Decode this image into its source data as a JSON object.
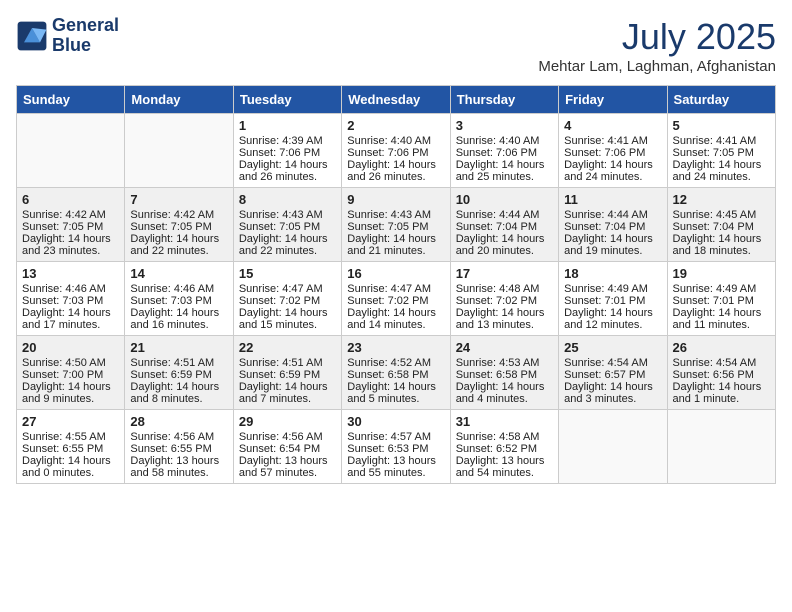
{
  "header": {
    "logo_line1": "General",
    "logo_line2": "Blue",
    "month": "July 2025",
    "location": "Mehtar Lam, Laghman, Afghanistan"
  },
  "weekdays": [
    "Sunday",
    "Monday",
    "Tuesday",
    "Wednesday",
    "Thursday",
    "Friday",
    "Saturday"
  ],
  "weeks": [
    [
      {
        "day": "",
        "sunrise": "",
        "sunset": "",
        "daylight": "",
        "empty": true
      },
      {
        "day": "",
        "sunrise": "",
        "sunset": "",
        "daylight": "",
        "empty": true
      },
      {
        "day": "1",
        "sunrise": "Sunrise: 4:39 AM",
        "sunset": "Sunset: 7:06 PM",
        "daylight": "Daylight: 14 hours and 26 minutes.",
        "empty": false
      },
      {
        "day": "2",
        "sunrise": "Sunrise: 4:40 AM",
        "sunset": "Sunset: 7:06 PM",
        "daylight": "Daylight: 14 hours and 26 minutes.",
        "empty": false
      },
      {
        "day": "3",
        "sunrise": "Sunrise: 4:40 AM",
        "sunset": "Sunset: 7:06 PM",
        "daylight": "Daylight: 14 hours and 25 minutes.",
        "empty": false
      },
      {
        "day": "4",
        "sunrise": "Sunrise: 4:41 AM",
        "sunset": "Sunset: 7:06 PM",
        "daylight": "Daylight: 14 hours and 24 minutes.",
        "empty": false
      },
      {
        "day": "5",
        "sunrise": "Sunrise: 4:41 AM",
        "sunset": "Sunset: 7:05 PM",
        "daylight": "Daylight: 14 hours and 24 minutes.",
        "empty": false
      }
    ],
    [
      {
        "day": "6",
        "sunrise": "Sunrise: 4:42 AM",
        "sunset": "Sunset: 7:05 PM",
        "daylight": "Daylight: 14 hours and 23 minutes.",
        "empty": false
      },
      {
        "day": "7",
        "sunrise": "Sunrise: 4:42 AM",
        "sunset": "Sunset: 7:05 PM",
        "daylight": "Daylight: 14 hours and 22 minutes.",
        "empty": false
      },
      {
        "day": "8",
        "sunrise": "Sunrise: 4:43 AM",
        "sunset": "Sunset: 7:05 PM",
        "daylight": "Daylight: 14 hours and 22 minutes.",
        "empty": false
      },
      {
        "day": "9",
        "sunrise": "Sunrise: 4:43 AM",
        "sunset": "Sunset: 7:05 PM",
        "daylight": "Daylight: 14 hours and 21 minutes.",
        "empty": false
      },
      {
        "day": "10",
        "sunrise": "Sunrise: 4:44 AM",
        "sunset": "Sunset: 7:04 PM",
        "daylight": "Daylight: 14 hours and 20 minutes.",
        "empty": false
      },
      {
        "day": "11",
        "sunrise": "Sunrise: 4:44 AM",
        "sunset": "Sunset: 7:04 PM",
        "daylight": "Daylight: 14 hours and 19 minutes.",
        "empty": false
      },
      {
        "day": "12",
        "sunrise": "Sunrise: 4:45 AM",
        "sunset": "Sunset: 7:04 PM",
        "daylight": "Daylight: 14 hours and 18 minutes.",
        "empty": false
      }
    ],
    [
      {
        "day": "13",
        "sunrise": "Sunrise: 4:46 AM",
        "sunset": "Sunset: 7:03 PM",
        "daylight": "Daylight: 14 hours and 17 minutes.",
        "empty": false
      },
      {
        "day": "14",
        "sunrise": "Sunrise: 4:46 AM",
        "sunset": "Sunset: 7:03 PM",
        "daylight": "Daylight: 14 hours and 16 minutes.",
        "empty": false
      },
      {
        "day": "15",
        "sunrise": "Sunrise: 4:47 AM",
        "sunset": "Sunset: 7:02 PM",
        "daylight": "Daylight: 14 hours and 15 minutes.",
        "empty": false
      },
      {
        "day": "16",
        "sunrise": "Sunrise: 4:47 AM",
        "sunset": "Sunset: 7:02 PM",
        "daylight": "Daylight: 14 hours and 14 minutes.",
        "empty": false
      },
      {
        "day": "17",
        "sunrise": "Sunrise: 4:48 AM",
        "sunset": "Sunset: 7:02 PM",
        "daylight": "Daylight: 14 hours and 13 minutes.",
        "empty": false
      },
      {
        "day": "18",
        "sunrise": "Sunrise: 4:49 AM",
        "sunset": "Sunset: 7:01 PM",
        "daylight": "Daylight: 14 hours and 12 minutes.",
        "empty": false
      },
      {
        "day": "19",
        "sunrise": "Sunrise: 4:49 AM",
        "sunset": "Sunset: 7:01 PM",
        "daylight": "Daylight: 14 hours and 11 minutes.",
        "empty": false
      }
    ],
    [
      {
        "day": "20",
        "sunrise": "Sunrise: 4:50 AM",
        "sunset": "Sunset: 7:00 PM",
        "daylight": "Daylight: 14 hours and 9 minutes.",
        "empty": false
      },
      {
        "day": "21",
        "sunrise": "Sunrise: 4:51 AM",
        "sunset": "Sunset: 6:59 PM",
        "daylight": "Daylight: 14 hours and 8 minutes.",
        "empty": false
      },
      {
        "day": "22",
        "sunrise": "Sunrise: 4:51 AM",
        "sunset": "Sunset: 6:59 PM",
        "daylight": "Daylight: 14 hours and 7 minutes.",
        "empty": false
      },
      {
        "day": "23",
        "sunrise": "Sunrise: 4:52 AM",
        "sunset": "Sunset: 6:58 PM",
        "daylight": "Daylight: 14 hours and 5 minutes.",
        "empty": false
      },
      {
        "day": "24",
        "sunrise": "Sunrise: 4:53 AM",
        "sunset": "Sunset: 6:58 PM",
        "daylight": "Daylight: 14 hours and 4 minutes.",
        "empty": false
      },
      {
        "day": "25",
        "sunrise": "Sunrise: 4:54 AM",
        "sunset": "Sunset: 6:57 PM",
        "daylight": "Daylight: 14 hours and 3 minutes.",
        "empty": false
      },
      {
        "day": "26",
        "sunrise": "Sunrise: 4:54 AM",
        "sunset": "Sunset: 6:56 PM",
        "daylight": "Daylight: 14 hours and 1 minute.",
        "empty": false
      }
    ],
    [
      {
        "day": "27",
        "sunrise": "Sunrise: 4:55 AM",
        "sunset": "Sunset: 6:55 PM",
        "daylight": "Daylight: 14 hours and 0 minutes.",
        "empty": false
      },
      {
        "day": "28",
        "sunrise": "Sunrise: 4:56 AM",
        "sunset": "Sunset: 6:55 PM",
        "daylight": "Daylight: 13 hours and 58 minutes.",
        "empty": false
      },
      {
        "day": "29",
        "sunrise": "Sunrise: 4:56 AM",
        "sunset": "Sunset: 6:54 PM",
        "daylight": "Daylight: 13 hours and 57 minutes.",
        "empty": false
      },
      {
        "day": "30",
        "sunrise": "Sunrise: 4:57 AM",
        "sunset": "Sunset: 6:53 PM",
        "daylight": "Daylight: 13 hours and 55 minutes.",
        "empty": false
      },
      {
        "day": "31",
        "sunrise": "Sunrise: 4:58 AM",
        "sunset": "Sunset: 6:52 PM",
        "daylight": "Daylight: 13 hours and 54 minutes.",
        "empty": false
      },
      {
        "day": "",
        "sunrise": "",
        "sunset": "",
        "daylight": "",
        "empty": true
      },
      {
        "day": "",
        "sunrise": "",
        "sunset": "",
        "daylight": "",
        "empty": true
      }
    ]
  ]
}
